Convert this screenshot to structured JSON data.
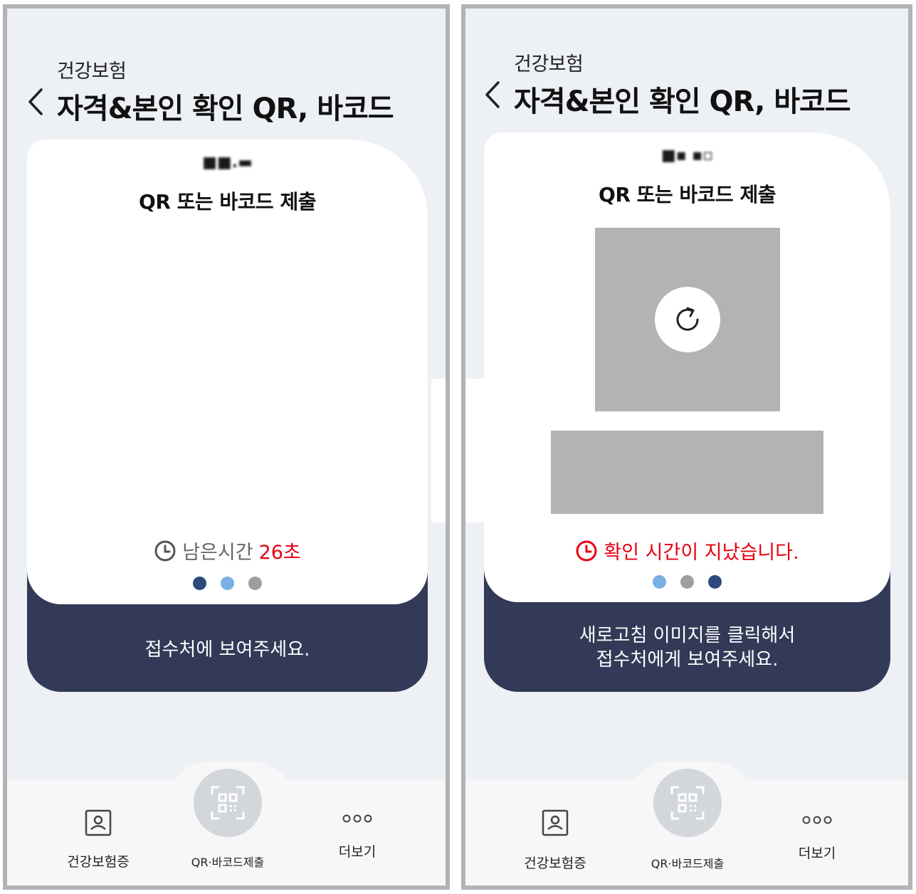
{
  "left": {
    "subtitle": "건강보험",
    "title": "자격&본인 확인 QR, 바코드",
    "masked_name": "■■.▬",
    "card_heading": "QR 또는 바코드 제출",
    "timer_label": "남은시간",
    "timer_value": "26초",
    "instruction": "접수처에 보여주세요.",
    "dots": [
      "#2c4a7c",
      "#7ab0e2",
      "#9c9ea3"
    ]
  },
  "right": {
    "subtitle": "건강보험",
    "title": "자격&본인 확인 QR, 바코드",
    "masked_name": "■▪ ▪▫",
    "card_heading": "QR 또는 바코드 제출",
    "expired_message": "확인 시간이 지났습니다.",
    "instruction_line1": "새로고침 이미지를 클릭해서",
    "instruction_line2": "접수처에게 보여주세요.",
    "dots": [
      "#7ab0e2",
      "#9c9ea3",
      "#2c4a7c"
    ]
  },
  "nav": {
    "items": [
      {
        "label": "건강보험증",
        "icon": "id-card-icon"
      },
      {
        "label": "QR·바코드제출",
        "icon": "qr-scan-icon"
      },
      {
        "label": "더보기",
        "icon": "more-dots-icon"
      }
    ]
  },
  "colors": {
    "accent_dark": "#323a57",
    "alert_red": "#e60012",
    "background": "#edf0f4"
  }
}
